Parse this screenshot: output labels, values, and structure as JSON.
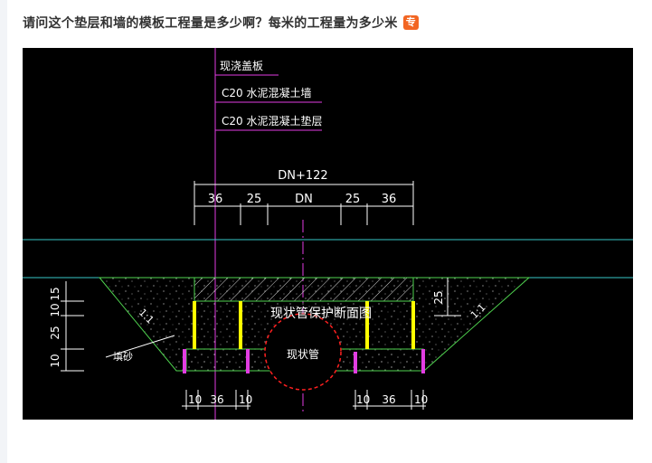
{
  "question": {
    "title": "请问这个垫层和墙的模板工程量是多少啊？每米的工程量为多少米",
    "badge": "专"
  },
  "drawing": {
    "callouts": [
      "现浇盖板",
      "C20 水泥混凝土墙",
      "C20 水泥混凝土垫层"
    ],
    "total_dimension": "DN+122",
    "top_dimensions": [
      "36",
      "25",
      "DN",
      "25",
      "36"
    ],
    "section_label": "现状管保护断面图",
    "pipe_label": "现状管",
    "sand_label": "填砂",
    "slope_left": "1:1",
    "slope_right": "1:1",
    "left_dimensions": [
      "15",
      "10",
      "25",
      "10"
    ],
    "right_dimension": "25",
    "bottom_left_dimensions": [
      "10",
      "36",
      "10"
    ],
    "bottom_right_dimensions": [
      "10",
      "36",
      "10"
    ]
  },
  "colors": {
    "title_text": "#333333",
    "badge_bg": "#f26522",
    "canvas_bg": "#000000",
    "cyan_line": "#39c7c7",
    "magenta": "#e23de2",
    "yellow": "#ffff00",
    "green_outline": "#4fd34f",
    "red_circle": "#ff2020"
  }
}
